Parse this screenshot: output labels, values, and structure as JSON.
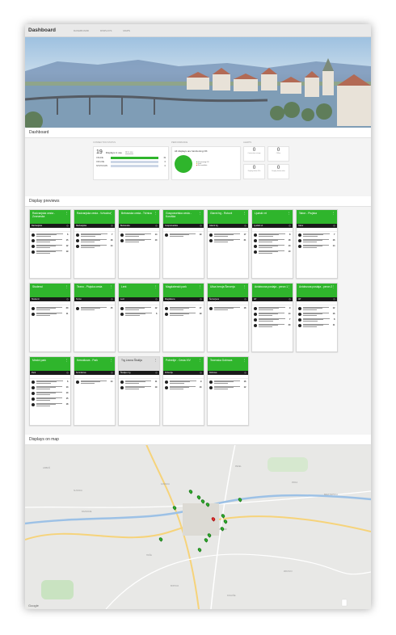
{
  "app": {
    "title": "Dashboard",
    "nav": [
      "DASHBOARD",
      "DISPLAYS",
      "MAPS"
    ]
  },
  "dashboard": {
    "heading": "Dashboard",
    "status_card": {
      "label": "CONNECTION STATUS",
      "count": "19",
      "caption": "Displays in use",
      "select_value": "All in use",
      "rows": [
        {
          "name": "ONLINE",
          "value": "19",
          "fraction": 1.0
        },
        {
          "name": "OFFLINE",
          "value": "0",
          "fraction": 0
        },
        {
          "name": "SHUTDOWN",
          "value": "0",
          "fraction": 0
        }
      ]
    },
    "performance_card": {
      "label": "PERFORMANCE",
      "message": "All displays are functioning OK",
      "legend": [
        "Functioning OK",
        "Fault",
        "Not available"
      ]
    },
    "alerts_card": {
      "label": "ALERTS",
      "tiles": [
        {
          "value": "0",
          "label": "Connection outage"
        },
        {
          "value": "0",
          "label": "Offline"
        },
        {
          "value": "0",
          "label": "Display failure 24h"
        },
        {
          "value": "0",
          "label": "Display failure other"
        }
      ]
    }
  },
  "previews": {
    "heading": "Display previews",
    "cards": [
      {
        "title": "Radvanjska cesta - Zvonarska",
        "stop": "Radvanjska",
        "rows": [
          "6",
          "15",
          "12",
          "19"
        ]
      },
      {
        "title": "Radvanjska cesta - Vzhodna",
        "stop": "Radvanjska",
        "rows": [
          "7",
          "18",
          "14"
        ]
      },
      {
        "title": "Betnavska cesta - Tržnica",
        "stop": "Betnavska",
        "rows": [
          "14",
          "10"
        ]
      },
      {
        "title": "Gosposvetska cesta - Koroška",
        "stop": "Gosposvetska",
        "rows": [
          "19"
        ]
      },
      {
        "title": "Glavni trg - Rotovž",
        "stop": "Glavni trg",
        "rows": [
          "17",
          "21"
        ]
      },
      {
        "title": "Ljudski vrt",
        "stop": "Ljudski vrt",
        "rows": [
          "8",
          "18",
          "13",
          "10"
        ]
      },
      {
        "title": "Tabor - Ptujska",
        "stop": "Tabor",
        "rows": [
          "7",
          "16",
          "14"
        ]
      },
      {
        "title": "Studenci",
        "stop": "Studenci",
        "rows": [
          "20",
          "11"
        ]
      },
      {
        "title": "Tezno - Ptujska cesta",
        "stop": "Tezno",
        "rows": [
          "15"
        ]
      },
      {
        "title": "Lent",
        "stop": "Lent",
        "rows": [
          "12",
          "6"
        ]
      },
      {
        "title": "Magdalenski park",
        "stop": "Magdalena",
        "rows": [
          "17",
          "19"
        ]
      },
      {
        "title": "Ulica heroja Šercerja",
        "stop": "Šercerjeva",
        "rows": [
          "18"
        ]
      },
      {
        "title": "Avtobusna postaja - peron 1",
        "stop": "AP",
        "rows": [
          "9",
          "14",
          "7",
          "20"
        ]
      },
      {
        "title": "Avtobusna postaja - peron 2",
        "stop": "AP",
        "rows": [
          "12",
          "16",
          "8",
          "11"
        ]
      },
      {
        "title": "Mestni park",
        "stop": "Park",
        "rows": [
          "6",
          "13",
          "10",
          "15",
          "18"
        ]
      },
      {
        "title": "Kersnikova - Park",
        "stop": "Kersnikova",
        "rows": [
          "14"
        ]
      },
      {
        "title": "Trg Leona Štuklja",
        "stop": "Štukljev trg",
        "rows": [
          "11",
          "19"
        ]
      },
      {
        "title": "Pobrežje - Cesta XIV",
        "stop": "Pobrežje",
        "rows": [
          "9",
          "13"
        ]
      },
      {
        "title": "Tezenska Dobrava",
        "stop": "Dobrava",
        "rows": [
          "16",
          "12"
        ]
      }
    ]
  },
  "map": {
    "heading": "Displays on map",
    "labels": [
      "LIMBUŠ",
      "SLIVNICA",
      "RAZVANJE",
      "HOČE",
      "BOHOVA",
      "KAMNICA",
      "PEKEL",
      "MAIBOR",
      "PIRKA",
      "BRESTERNICA",
      "ZRKOVCI",
      "DOGOŠE"
    ],
    "brand": "Google"
  }
}
